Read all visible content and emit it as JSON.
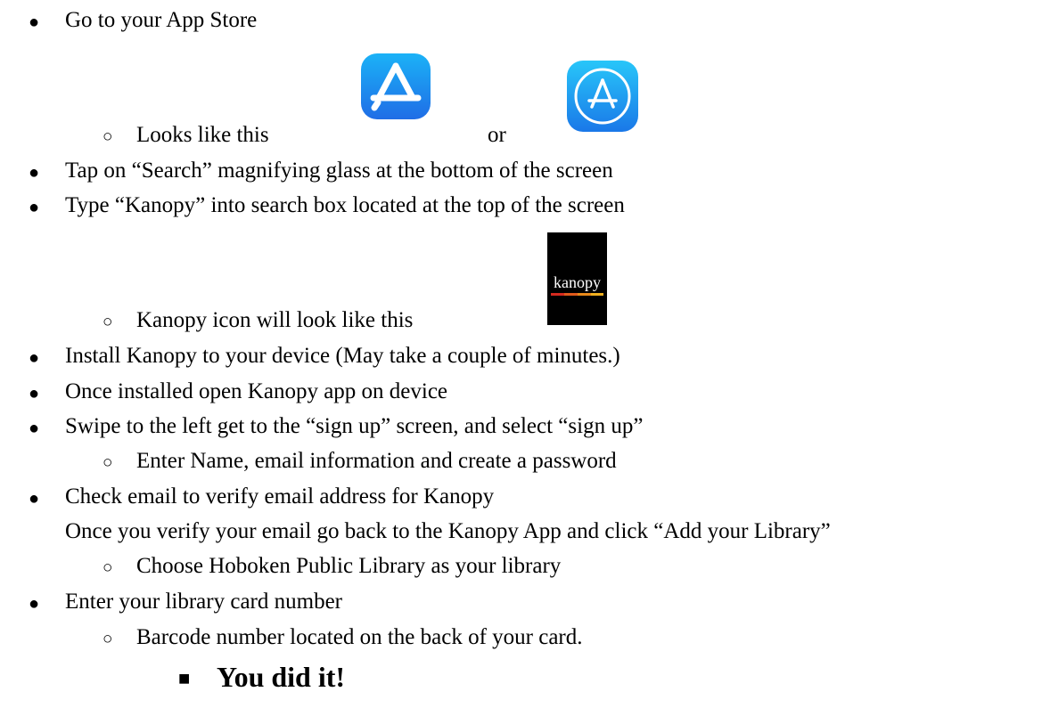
{
  "steps": [
    {
      "text": "Go to your App Store"
    },
    {
      "text": "Looks like this"
    },
    {
      "text": "or"
    },
    {
      "text": "Tap on “Search” magnifying glass at the bottom of the screen"
    },
    {
      "text": "Type “Kanopy” into search box located at the top of the screen"
    },
    {
      "text": "Kanopy icon will look like this"
    },
    {
      "text": "Install Kanopy to your device (May take a couple of minutes.)"
    },
    {
      "text": "Once installed open Kanopy app on device"
    },
    {
      "text": "Swipe to the left get to the “sign up” screen, and select “sign up”"
    },
    {
      "text": "Enter Name, email information and create a password"
    },
    {
      "text": "Check email to verify email address for Kanopy"
    },
    {
      "text": "Once you verify your email go back to the Kanopy App and click  “Add your Library”"
    },
    {
      "text": "Choose Hoboken Public Library as your library"
    },
    {
      "text": "Enter your library card number"
    },
    {
      "text": "Barcode number located on the back of your card."
    },
    {
      "text": "You did it!"
    }
  ],
  "markers": {
    "bullet": "●",
    "circle": "○",
    "square": "■"
  },
  "icons": {
    "app_store_new": "app-store-icon",
    "app_store_old": "app-store-circle-icon",
    "kanopy": "kanopy-logo-icon",
    "kanopy_label": "kanopy"
  },
  "colors": {
    "text": "#000000",
    "app_store_blue": "#1d8cf0",
    "kanopy_bg": "#000000",
    "kanopy_stripe_red": "#d42a1f",
    "kanopy_stripe_orange": "#e8891a"
  }
}
